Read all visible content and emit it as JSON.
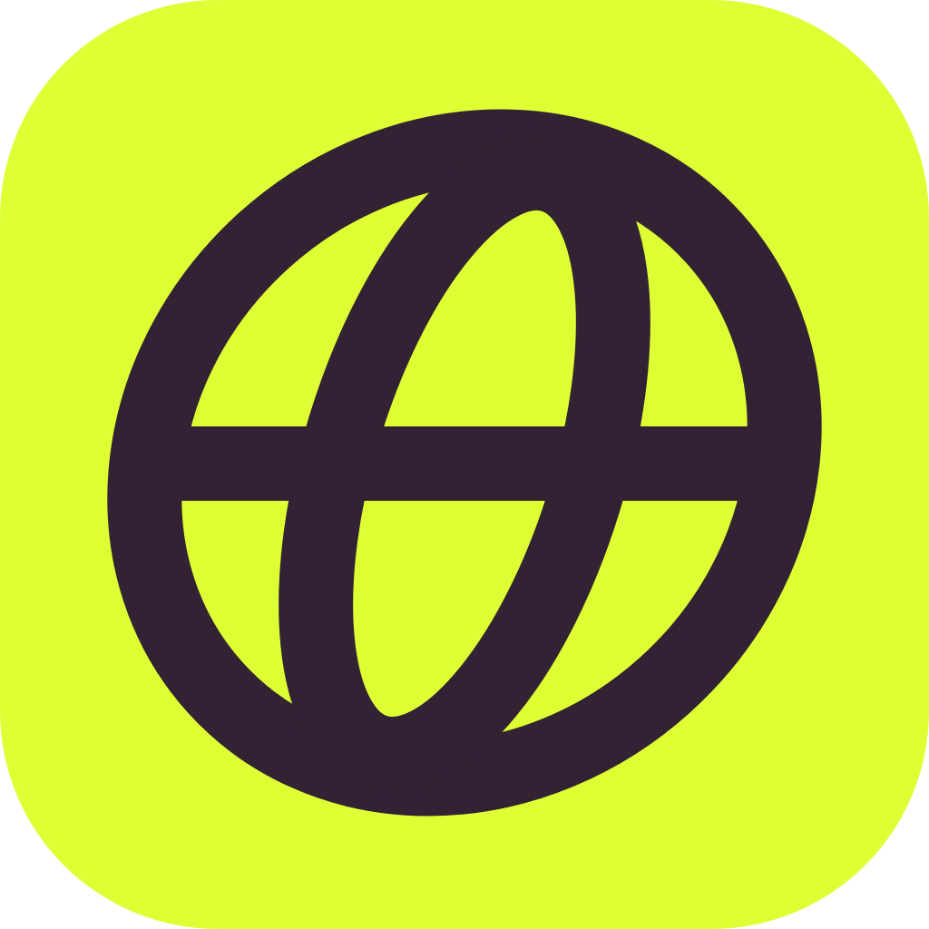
{
  "icon": {
    "name": "globe-icon",
    "colors": {
      "background": "#DDFF33",
      "foreground": "#332233"
    }
  }
}
